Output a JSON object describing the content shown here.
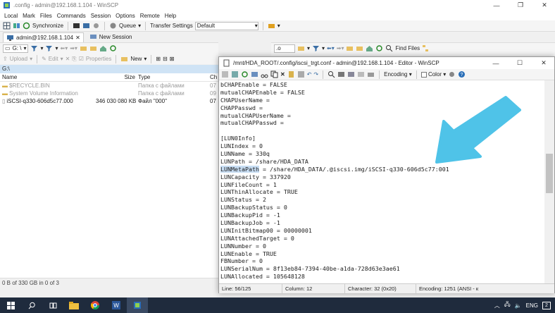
{
  "main_window": {
    "title": ".config - admin@192.168.1.104 - WinSCP",
    "menu": [
      "Local",
      "Mark",
      "Files",
      "Commands",
      "Session",
      "Options",
      "Remote",
      "Help"
    ],
    "toolbar": {
      "synchronize": "Synchronize",
      "queue": "Queue",
      "transfer_settings": "Transfer Settings",
      "transfer_profile": "Default"
    },
    "sessions": {
      "active": "admin@192.168.1.104",
      "new": "New Session"
    },
    "local_panel": {
      "drive": "G: \\",
      "upload": "Upload",
      "edit": "Edit",
      "properties": "Properties",
      "new": "New",
      "path": "G:\\",
      "columns": {
        "name": "Name",
        "size": "Size",
        "type": "Type",
        "changed": "Ch"
      },
      "files": [
        {
          "name": "$RECYCLE.BIN",
          "size": "",
          "type": "Папка с файлами",
          "changed": "07"
        },
        {
          "name": "System Volume Information",
          "size": "",
          "type": "Папка с файлами",
          "changed": "09"
        },
        {
          "name": "iSCSI-q330-606d5c77.000",
          "size": "346 030 080 KB",
          "type": "Файл \"000\"",
          "changed": "07"
        }
      ]
    },
    "remote_panel": {
      "path_label": ".o",
      "find_files": "Find Files"
    },
    "status": "0 B of 330 GB in 0 of 3"
  },
  "editor": {
    "title": "/mnt/HDA_ROOT/.config/iscsi_trgt.conf - admin@192.168.1.104 - Editor - WinSCP",
    "encoding_label": "Encoding",
    "color_label": "Color",
    "lines": [
      "bCHAPEnable = FALSE",
      "mutualCHAPEnable = FALSE",
      "CHAPUserName =",
      "CHAPPasswd =",
      "mutualCHAPUserName =",
      "mutualCHAPPasswd =",
      "",
      "[LUN0Info]",
      "LUNIndex = 0",
      "LUNName = 330q",
      "LUNPath = /share/HDA_DATA",
      "LUNMetaPath = /share/HDA_DATA/.@iscsi.img/iSCSI-q330-606d5c77:001",
      "LUNCapacity = 337920",
      "LUNFileCount = 1",
      "LUNThinAllocate = TRUE",
      "LUNStatus = 2",
      "LUNBackupStatus = 0",
      "LUNBackupPid = -1",
      "LUNBackupJob = -1",
      "LUNInitBitmap00 = 00000001",
      "LUNAttachedTarget = 0",
      "LUNNumber = 0",
      "LUNEnable = TRUE",
      "FBNumber = 0",
      "LUNSerialNum = 8f13eb84-7394-40be-a1da-728d63e3ae61",
      "LUNAllocated = 105648128"
    ],
    "highlight": {
      "line": 11,
      "text": "LUNMetaPath"
    },
    "status": {
      "line": "Line: 56/125",
      "column": "Column: 12",
      "character": "Character: 32 (0x20)",
      "encoding": "Encoding: 1251  (ANSI - к"
    }
  },
  "taskbar": {
    "language": "ENG",
    "notification_count": "2"
  },
  "colors": {
    "arrow": "#4fc3e8",
    "highlight": "#c7ddf3",
    "taskbar": "#1f2b3d"
  }
}
